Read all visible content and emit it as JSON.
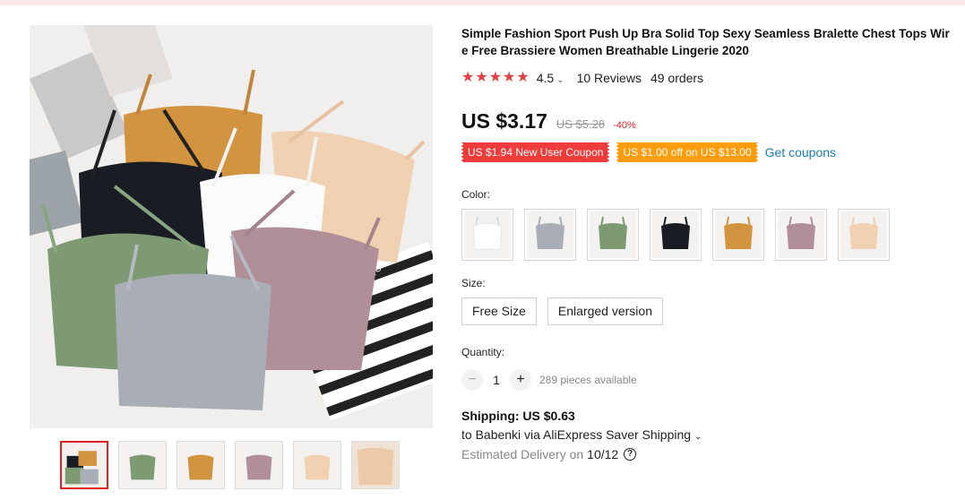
{
  "product": {
    "title": "Simple Fashion Sport Push Up Bra Solid Top Sexy Seamless Bralette Chest Tops Wire Free Brassiere Women Breathable Lingerie 2020",
    "rating": "4.5",
    "reviews": "10 Reviews",
    "orders": "49 orders",
    "price": "US $3.17",
    "original_price": "US $5.28",
    "discount": "-40%"
  },
  "main_image_text": "THANK YOU",
  "coupons": {
    "new_user": "US $1.94 New User Coupon",
    "store": "US $1.00 off on US $13.00",
    "link": "Get coupons"
  },
  "colors": {
    "label": "Color:",
    "options": [
      {
        "name": "white",
        "hex": "#f4f4f4"
      },
      {
        "name": "grey",
        "hex": "#a9adb6"
      },
      {
        "name": "green",
        "hex": "#7d9a72"
      },
      {
        "name": "black",
        "hex": "#1a1c24"
      },
      {
        "name": "ochre",
        "hex": "#d39440"
      },
      {
        "name": "mauve",
        "hex": "#b08f98"
      },
      {
        "name": "beige",
        "hex": "#f0d1b2"
      }
    ]
  },
  "sizes": {
    "label": "Size:",
    "options": [
      "Free Size",
      "Enlarged version"
    ]
  },
  "quantity": {
    "label": "Quantity:",
    "value": "1",
    "minus": "−",
    "plus": "+",
    "available": "289 pieces available"
  },
  "shipping": {
    "title": "Shipping: US $0.63",
    "to": "to Babenki via AliExpress Saver Shipping",
    "delivery_prefix": "Estimated Delivery on",
    "delivery_date": "10/12",
    "help": "?"
  },
  "icons": {
    "star": "star-icon",
    "chevron": "chevron-down-icon",
    "help": "question-icon"
  },
  "thumbnails": [
    {
      "colors": [
        "#1a1c24",
        "#7d9a72",
        "#d39440"
      ],
      "active": true
    },
    {
      "colors": [
        "#7d9a72"
      ],
      "active": false
    },
    {
      "colors": [
        "#d39440"
      ],
      "active": false
    },
    {
      "colors": [
        "#b08f98"
      ],
      "active": false
    },
    {
      "colors": [
        "#f0d1b2"
      ],
      "active": false
    },
    {
      "colors": [
        "#ecc9a8"
      ],
      "active": false
    }
  ]
}
